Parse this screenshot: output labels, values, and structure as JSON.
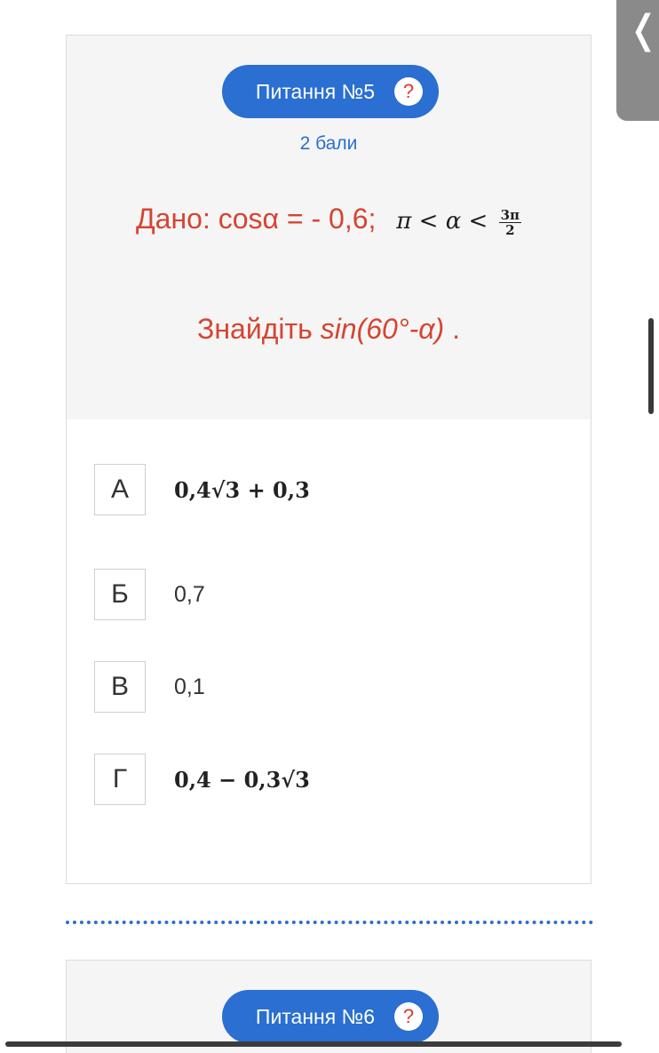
{
  "question5": {
    "title": "Питання №5",
    "help_icon": "?",
    "points": "2 бали",
    "given_label": "Дано: cosα = - 0,6;",
    "given_condition": "π < α <",
    "given_fraction_num": "3π",
    "given_fraction_den": "2",
    "find_label": "Знайдіть",
    "find_expr": "sin(60°-α)",
    "find_end": " .",
    "options": [
      {
        "letter": "А",
        "text": "0,4√3 + 0,3"
      },
      {
        "letter": "Б",
        "text": "0,7"
      },
      {
        "letter": "В",
        "text": "0,1"
      },
      {
        "letter": "Г",
        "text": "0,4 − 0,3√3"
      }
    ]
  },
  "question6": {
    "title": "Питання №6",
    "help_icon": "?"
  },
  "side_tab": {
    "icon": "chevron-left-icon",
    "glyph": "❬"
  },
  "colors": {
    "accent": "#2a6fd1",
    "question_text": "#d64432",
    "help_mark": "#e0392b"
  }
}
